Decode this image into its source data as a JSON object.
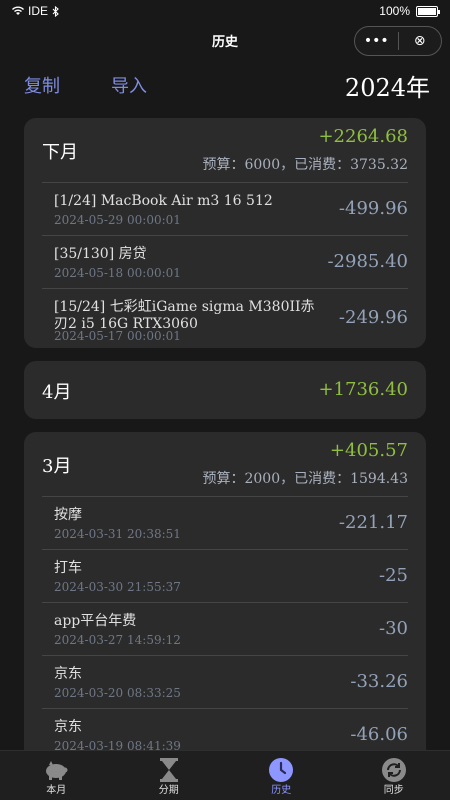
{
  "status": {
    "carrier": "IDE",
    "battery": "100%"
  },
  "nav": {
    "title": "历史",
    "more": "•••",
    "close": "⊗"
  },
  "toolbar": {
    "copy": "复制",
    "import": "导入",
    "year": "2024年"
  },
  "cards": [
    {
      "month": "下月",
      "total": "+2264.68",
      "budget": "预算：6000，已消费：3735.32",
      "items": [
        {
          "name": "[1/24] MacBook Air m3 16 512",
          "date": "2024-05-29 00:00:01",
          "amount": "-499.96"
        },
        {
          "name": "[35/130] 房贷",
          "date": "2024-05-18 00:00:01",
          "amount": "-2985.40"
        },
        {
          "name": "[15/24] 七彩虹iGame sigma M380II赤刃2 i5 16G RTX3060",
          "date": "2024-05-17 00:00:01",
          "amount": "-249.96"
        }
      ]
    },
    {
      "month": "4月",
      "total": "+1736.40"
    },
    {
      "month": "3月",
      "total": "+405.57",
      "budget": "预算：2000，已消费：1594.43",
      "items": [
        {
          "name": "按摩",
          "date": "2024-03-31 20:38:51",
          "amount": "-221.17"
        },
        {
          "name": "打车",
          "date": "2024-03-30 21:55:37",
          "amount": "-25"
        },
        {
          "name": "app平台年费",
          "date": "2024-03-27 14:59:12",
          "amount": "-30"
        },
        {
          "name": "京东",
          "date": "2024-03-20 08:33:25",
          "amount": "-33.26"
        },
        {
          "name": "京东",
          "date": "2024-03-19 08:41:39",
          "amount": "-46.06"
        }
      ]
    }
  ],
  "tabs": [
    {
      "label": "本月",
      "icon": "piggy-bank-icon"
    },
    {
      "label": "分期",
      "icon": "hourglass-icon"
    },
    {
      "label": "历史",
      "icon": "clock-icon",
      "active": true
    },
    {
      "label": "同步",
      "icon": "sync-icon"
    }
  ],
  "colors": {
    "accent": "#7e8de0",
    "positive": "#8fbf3f",
    "amount": "#93a2b8"
  }
}
